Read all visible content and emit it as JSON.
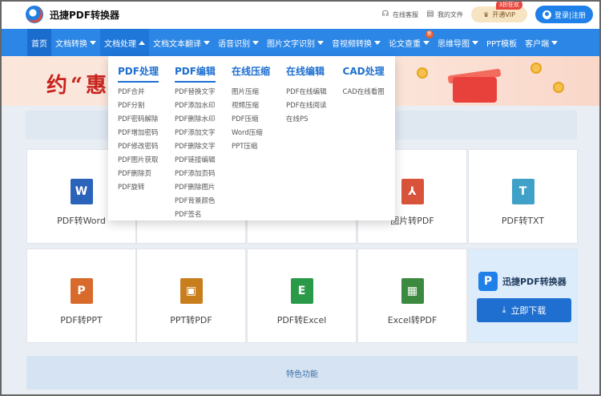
{
  "header": {
    "brand": "迅捷PDF转换器",
    "links": [
      {
        "label": "在线客服",
        "icon": "headset-icon"
      },
      {
        "label": "我的文件",
        "icon": "file-icon"
      }
    ],
    "vip": {
      "label": "开通VIP",
      "badge": "3折狂欢"
    },
    "login": {
      "label": "登录|注册"
    }
  },
  "nav": {
    "items": [
      {
        "label": "首页",
        "caret": false
      },
      {
        "label": "文档转换",
        "caret": true
      },
      {
        "label": "文档处理",
        "caret": true,
        "open": true
      },
      {
        "label": "文档文本翻译",
        "caret": true
      },
      {
        "label": "语音识别",
        "caret": true
      },
      {
        "label": "图片文字识别",
        "caret": true
      },
      {
        "label": "音视频转换",
        "caret": true
      },
      {
        "label": "论文查重",
        "caret": true,
        "badge": "新"
      },
      {
        "label": "思维导图",
        "caret": true
      },
      {
        "label": "PPT模板",
        "caret": false
      },
      {
        "label": "客户端",
        "caret": true
      }
    ]
  },
  "banner": {
    "text": "约“惠"
  },
  "dropdown": {
    "columns": [
      {
        "title": "PDF处理",
        "items": [
          "PDF合并",
          "PDF分割",
          "PDF密码解除",
          "PDF增加密码",
          "PDF修改密码",
          "PDF图片获取",
          "PDF删除页",
          "PDF旋转"
        ]
      },
      {
        "title": "PDF编辑",
        "items": [
          "PDF替换文字",
          "PDF添加水印",
          "PDF删除水印",
          "PDF添加文字",
          "PDF删除文字",
          "PDF链接编辑",
          "PDF添加页码",
          "PDF删除图片",
          "PDF背景颜色",
          "PDF签名"
        ]
      },
      {
        "title": "在线压缩",
        "items": [
          "图片压缩",
          "视频压缩",
          "PDF压缩",
          "Word压缩",
          "PPT压缩"
        ]
      },
      {
        "title": "在线编辑",
        "items": [
          "PDF在线编辑",
          "PDF在线阅读",
          "在线PS"
        ]
      },
      {
        "title": "CAD处理",
        "items": [
          "CAD在线看图"
        ]
      }
    ]
  },
  "tools": [
    {
      "label": "PDF转Word",
      "icon": "word-icon",
      "glyph": "W",
      "color": "#2a63b9"
    },
    {
      "label": "图片转PDF",
      "icon": "pdf-icon",
      "glyph": "⅄",
      "color": "#d9533a"
    },
    {
      "label": "PDF转TXT",
      "icon": "txt-icon",
      "glyph": "T",
      "color": "#3fa1c8"
    },
    {
      "label": "PDF转PPT",
      "icon": "ppt-icon",
      "glyph": "P",
      "color": "#d86b2c"
    },
    {
      "label": "PPT转PDF",
      "icon": "ppt-pdf-icon",
      "glyph": "▣",
      "color": "#c97e1d"
    },
    {
      "label": "PDF转Excel",
      "icon": "excel-icon",
      "glyph": "E",
      "color": "#2b9a48"
    },
    {
      "label": "Excel转PDF",
      "icon": "excel-pdf-icon",
      "glyph": "▦",
      "color": "#3c8a40"
    }
  ],
  "promo": {
    "brand": "迅捷PDF转换器",
    "download_label": "立即下载"
  },
  "footer": {
    "label": "特色功能"
  }
}
